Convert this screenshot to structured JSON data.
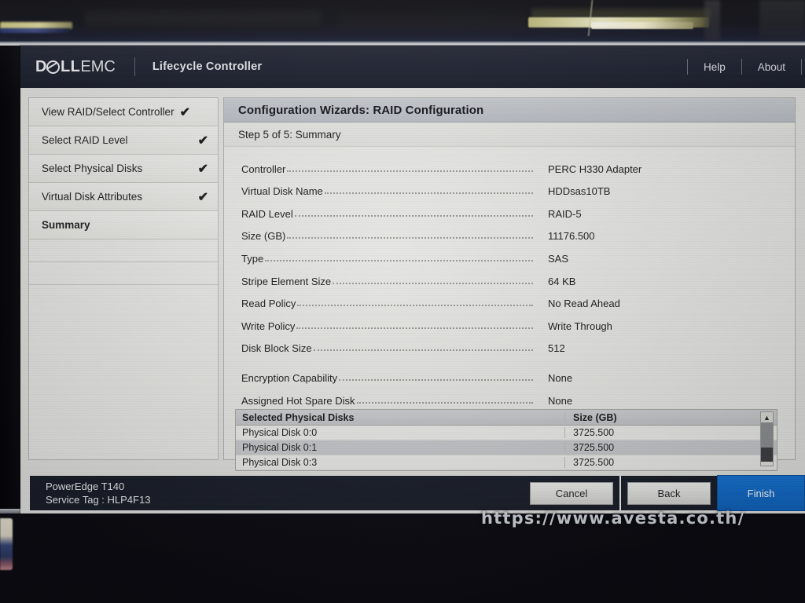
{
  "header": {
    "brand_dell": "D",
    "brand_dell_rest": "LL",
    "brand_emc": "EMC",
    "app_title": "Lifecycle Controller",
    "help_label": "Help",
    "about_label": "About"
  },
  "sidebar": {
    "items": [
      {
        "label": "View RAID/Select Controller",
        "check": "✔",
        "active": false
      },
      {
        "label": "Select RAID Level",
        "check": "✔",
        "active": false
      },
      {
        "label": "Select Physical Disks",
        "check": "✔",
        "active": false
      },
      {
        "label": "Virtual Disk Attributes",
        "check": "✔",
        "active": false
      },
      {
        "label": "Summary",
        "check": "",
        "active": true
      }
    ]
  },
  "main": {
    "panel_title": "Configuration Wizards: RAID Configuration",
    "step_label": "Step 5 of 5: Summary",
    "summary_rows": [
      {
        "key": "Controller",
        "value": "PERC H330 Adapter"
      },
      {
        "key": "Virtual Disk Name",
        "value": "HDDsas10TB"
      },
      {
        "key": "RAID Level",
        "value": "RAID-5"
      },
      {
        "key": "Size (GB)",
        "value": "11176.500"
      },
      {
        "key": "Type",
        "value": "SAS"
      },
      {
        "key": "Stripe Element Size",
        "value": "64 KB"
      },
      {
        "key": "Read Policy",
        "value": "No Read Ahead"
      },
      {
        "key": "Write Policy",
        "value": "Write Through"
      },
      {
        "key": "Disk Block Size",
        "value": "512"
      },
      {
        "key": "Encryption Capability",
        "value": "None"
      },
      {
        "key": "Assigned Hot Spare Disk",
        "value": "None"
      }
    ],
    "table": {
      "columns": [
        "Selected Physical Disks",
        "Size (GB)"
      ],
      "rows": [
        [
          "Physical Disk 0:0",
          "3725.500"
        ],
        [
          "Physical Disk 0:1",
          "3725.500"
        ],
        [
          "Physical Disk 0:3",
          "3725.500"
        ]
      ],
      "scroll_up_icon": "▲"
    }
  },
  "footer": {
    "model": "PowerEdge T140",
    "service_tag": "Service Tag : HLP4F13",
    "buttons": {
      "cancel": "Cancel",
      "back": "Back",
      "finish": "Finish"
    }
  },
  "watermark": "https://www.avesta.co.th/",
  "colors": {
    "header_bg": "#191d2a",
    "primary_button": "#1167c9",
    "panel_title_bg": "#c2c5cb",
    "window_bg": "#e2e2e0"
  }
}
